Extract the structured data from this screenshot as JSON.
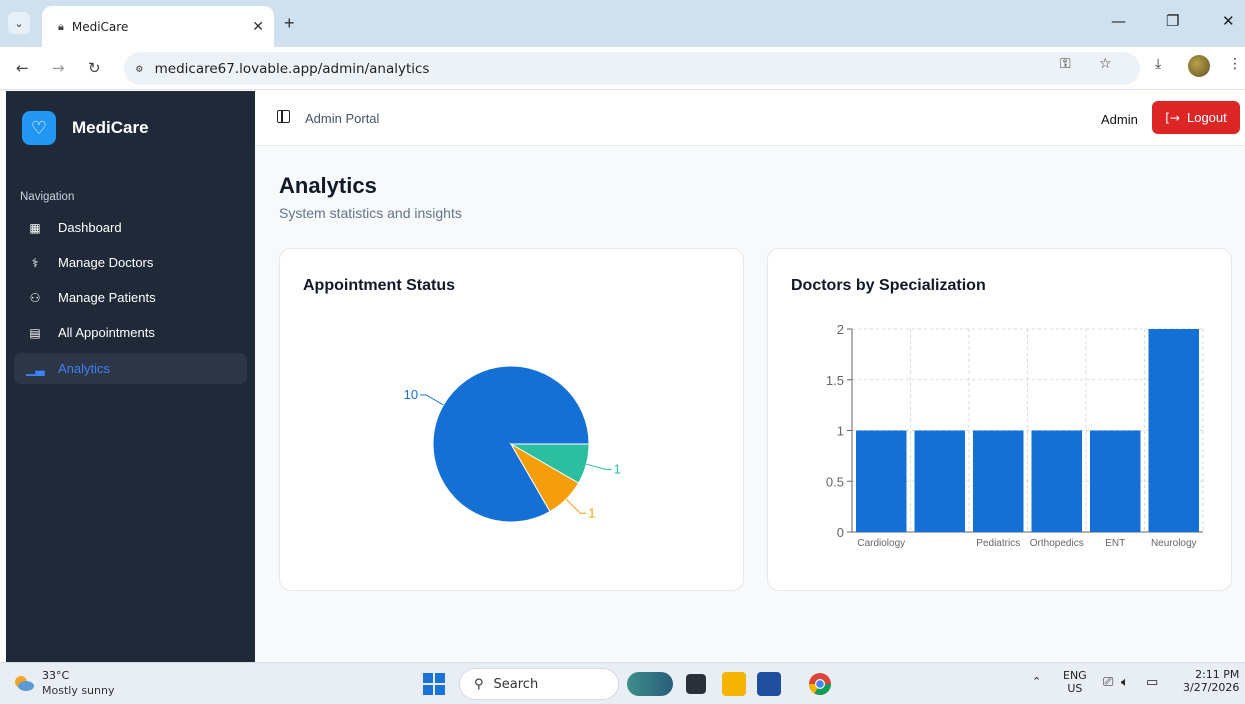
{
  "browser": {
    "tab_title": "MediCare",
    "url": "medicare67.lovable.app/admin/analytics"
  },
  "sidebar": {
    "brand": "MediCare",
    "section_label": "Navigation",
    "items": [
      {
        "label": "Dashboard",
        "icon": "grid-icon"
      },
      {
        "label": "Manage Doctors",
        "icon": "stethoscope-icon"
      },
      {
        "label": "Manage Patients",
        "icon": "users-icon"
      },
      {
        "label": "All Appointments",
        "icon": "clipboard-icon"
      },
      {
        "label": "Analytics",
        "icon": "bar-chart-icon",
        "active": true
      }
    ]
  },
  "header": {
    "portal_label": "Admin Portal",
    "user_name": "Admin",
    "logout_label": "Logout"
  },
  "page": {
    "title": "Analytics",
    "subtitle": "System statistics and insights"
  },
  "chart_data": [
    {
      "type": "pie",
      "title": "Appointment Status",
      "slices": [
        {
          "value": 10,
          "label": "10",
          "color": "#1570d5"
        },
        {
          "value": 1,
          "label": "1",
          "color": "#f59e0b"
        },
        {
          "value": 1,
          "label": "1",
          "color": "#2bbfa0"
        }
      ]
    },
    {
      "type": "bar",
      "title": "Doctors by Specialization",
      "categories": [
        "Cardiology",
        "",
        "Pediatrics",
        "Orthopedics",
        "ENT",
        "Neurology"
      ],
      "values": [
        1,
        1,
        1,
        1,
        1,
        2
      ],
      "ylim": [
        0,
        2
      ],
      "yticks": [
        "0",
        "0.5",
        "1",
        "1.5",
        "2"
      ],
      "grid": true,
      "color": "#1570d5"
    }
  ],
  "taskbar": {
    "temperature": "33°C",
    "condition": "Mostly sunny",
    "search_label": "Search",
    "lang_top": "ENG",
    "lang_bottom": "US",
    "time": "2:11 PM",
    "date": "3/27/2026"
  }
}
